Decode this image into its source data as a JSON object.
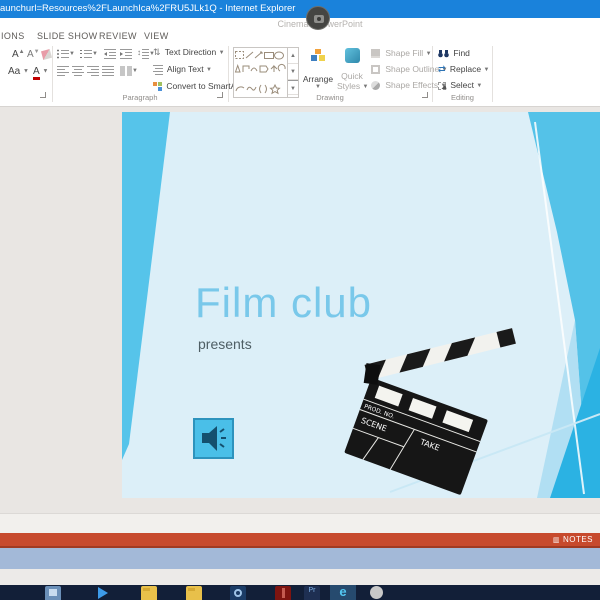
{
  "window": {
    "ie_title": "aunchurl=Resources%2FLaunchIca%2FRU5JLk1Q - Internet Explorer",
    "app_title": "Cinema - PowerPoint"
  },
  "ribbon": {
    "tabs": [
      {
        "label": "IONS"
      },
      {
        "label": "SLIDE SHOW"
      },
      {
        "label": "REVIEW"
      },
      {
        "label": "VIEW"
      }
    ],
    "font": {
      "grow_font": "A",
      "shrink_font": "A",
      "change_case": "Aa",
      "font_color": "A"
    },
    "paragraph": {
      "label": "Paragraph",
      "text_direction": "Text Direction",
      "align_text": "Align Text",
      "convert_smartart": "Convert to SmartArt"
    },
    "drawing": {
      "label": "Drawing",
      "arrange": "Arrange",
      "quick_styles_line1": "Quick",
      "quick_styles_line2": "Styles",
      "shape_fill": "Shape Fill",
      "shape_outline": "Shape Outline",
      "shape_effects": "Shape Effects"
    },
    "editing": {
      "label": "Editing",
      "find": "Find",
      "replace": "Replace",
      "select": "Select"
    }
  },
  "slide": {
    "title": "Film club",
    "subtitle": "presents",
    "clapperboard": {
      "prod_no": "PROD. NO.",
      "scene": "SCENE",
      "take": "TAKE"
    }
  },
  "status_bar": {
    "notes": "NOTES"
  },
  "taskbar": {
    "icons": [
      "blue-app",
      "media-play",
      "yellow-folder-1",
      "yellow-folder-2",
      "outlook-app",
      "red-app",
      "pr-app",
      "internet-explorer",
      "gray-sphere-app"
    ]
  },
  "colors": {
    "ie_titlebar": "#1A82DB",
    "status_bar": "#C74A2D",
    "slide_background": "#DCEFF8",
    "slide_accent_band": "#54C2E8",
    "slide_accent_strong": "#2BB2E3",
    "slide_title_text": "#79C8EA",
    "subtitle_text": "#4E5E64",
    "taskbar": "#121F38"
  }
}
